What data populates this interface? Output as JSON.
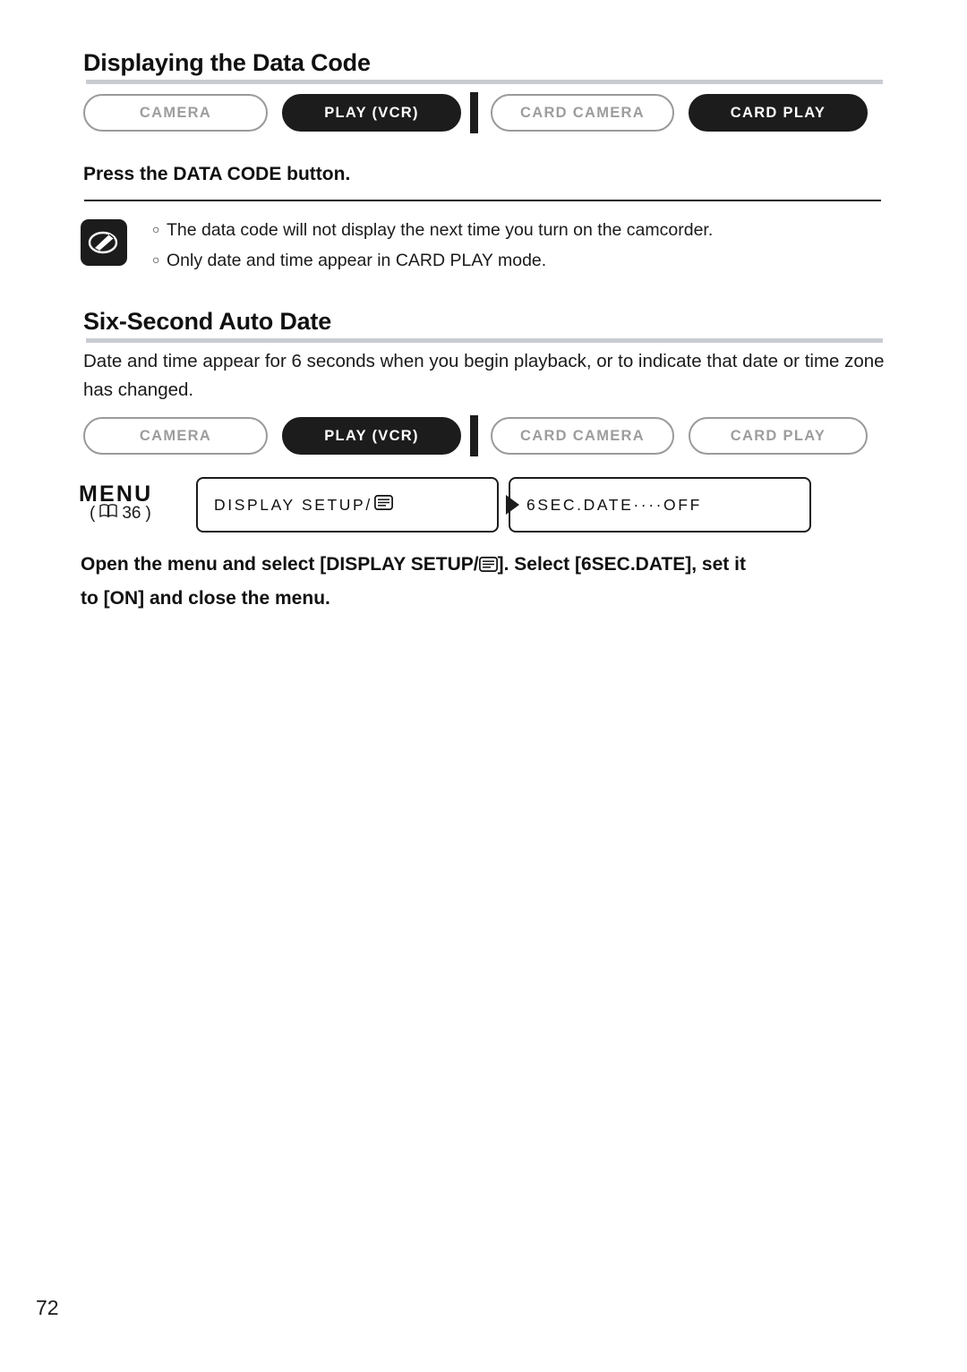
{
  "page": {
    "number": "72"
  },
  "section1": {
    "title": "Displaying the Data Code",
    "modes": [
      {
        "label": "CAMERA",
        "state": "off"
      },
      {
        "label": "PLAY (VCR)",
        "state": "on"
      },
      {
        "label": "CARD CAMERA",
        "state": "off"
      },
      {
        "label": "CARD PLAY",
        "state": "on"
      }
    ],
    "instruction": "Press the DATA CODE button.",
    "notes": [
      "The data code will not display the next time you turn on the camcorder.",
      "Only date and time appear in CARD PLAY mode."
    ],
    "note_icon": "pencil-note-icon"
  },
  "section2": {
    "title": "Six-Second Auto Date",
    "paragraph": "Date and time appear for 6 seconds when you begin playback, or to indicate that date or time zone has changed.",
    "modes": [
      {
        "label": "CAMERA",
        "state": "off"
      },
      {
        "label": "PLAY (VCR)",
        "state": "on"
      },
      {
        "label": "CARD CAMERA",
        "state": "off"
      },
      {
        "label": "CARD PLAY",
        "state": "off"
      }
    ],
    "menu": {
      "label": "MENU",
      "ref_open": "(",
      "ref_page": "36",
      "ref_close": ")",
      "ref_icon": "book-icon",
      "item1": "DISPLAY SETUP/",
      "item1_icon": "tv-screen-icon",
      "arrow_icon": "arrow-right-icon",
      "item2": "6SEC.DATE····OFF"
    },
    "instruction_line1": "Open the menu and select [DISPLAY SETUP/",
    "instruction_icon": "tv-screen-icon",
    "instruction_line1b": "]. Select [6SEC.DATE], set it",
    "instruction_line2": "to [ON] and close the menu."
  }
}
